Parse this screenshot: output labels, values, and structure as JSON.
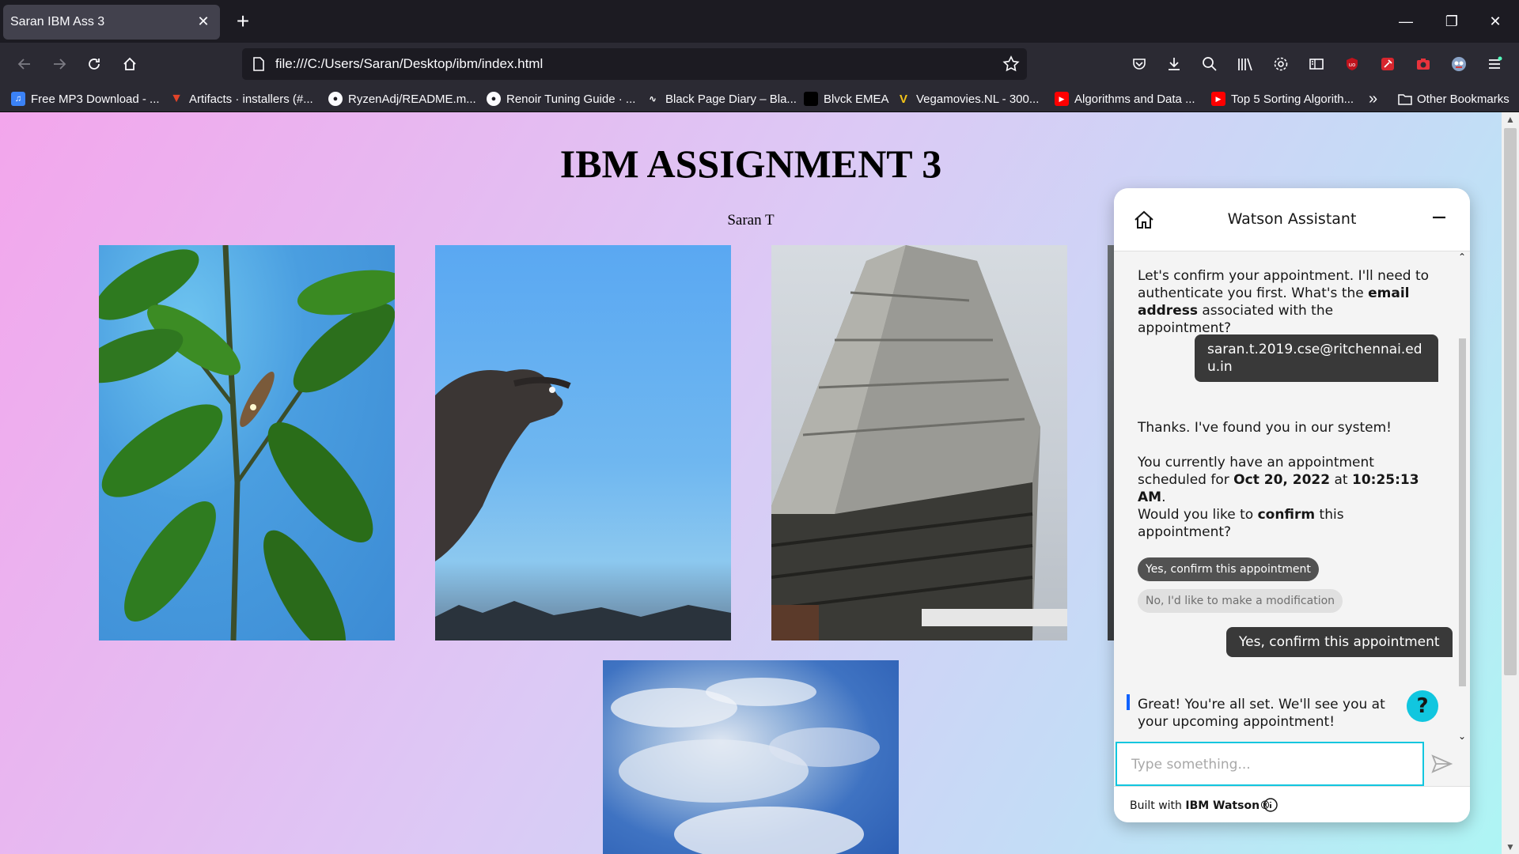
{
  "browser": {
    "tab_title": "Saran IBM Ass 3",
    "url": "file:///C:/Users/Saran/Desktop/ibm/index.html",
    "bookmarks": [
      {
        "label": "Free MP3 Download - ...",
        "icon": "music-note-icon",
        "color": "#3b82f6"
      },
      {
        "label": "Artifacts · installers (#...",
        "icon": "gitlab-icon",
        "color": "#e24329"
      },
      {
        "label": "RyzenAdj/README.m...",
        "icon": "github-icon",
        "color": "#ffffff"
      },
      {
        "label": "Renoir Tuning Guide · ...",
        "icon": "github-icon",
        "color": "#ffffff"
      },
      {
        "label": "Black Page Diary – Bla...",
        "icon": "signature-icon",
        "color": "#ffffff"
      },
      {
        "label": "Blvck EMEA",
        "icon": "blvck-icon",
        "color": "#000000"
      },
      {
        "label": "Vegamovies.NL - 300...",
        "icon": "v-logo-icon",
        "color": "#f5c518"
      },
      {
        "label": "Algorithms and Data ...",
        "icon": "youtube-icon",
        "color": "#ff0000"
      },
      {
        "label": "Top 5 Sorting Algorith...",
        "icon": "youtube-icon",
        "color": "#ff0000"
      }
    ],
    "other_bookmarks": "Other Bookmarks"
  },
  "page": {
    "title": "IBM ASSIGNMENT 3",
    "author": "Saran T"
  },
  "watson": {
    "title": "Watson Assistant",
    "msg1_a": "Let's confirm your appointment. I'll need to authenticate you first. What's the ",
    "msg1_b": "email address",
    "msg1_c": " associated with the appointment?",
    "user_email": "saran.t.2019.cse@ritchennai.edu.in",
    "msg2": "Thanks. I've found you in our system!",
    "msg3_a": "You currently have an appointment scheduled for ",
    "msg3_date": "Oct 20, 2022",
    "msg3_at": " at ",
    "msg3_time": "10:25:13 AM",
    "msg3_end": ".",
    "msg4_a": "Would you like to ",
    "msg4_b": "confirm",
    "msg4_c": " this appointment?",
    "option_yes": "Yes, confirm this appointment",
    "option_no": "No, I'd like to make a modification",
    "user_reply": "Yes, confirm this appointment",
    "msg5": "Great! You're all set. We'll see you at your upcoming appointment!",
    "input_placeholder": "Type something...",
    "footer_prefix": "Built with ",
    "footer_brand": "IBM Watson®",
    "help_label": "?"
  },
  "colors": {
    "accent": "#11c6df",
    "user_bubble": "#393939"
  }
}
